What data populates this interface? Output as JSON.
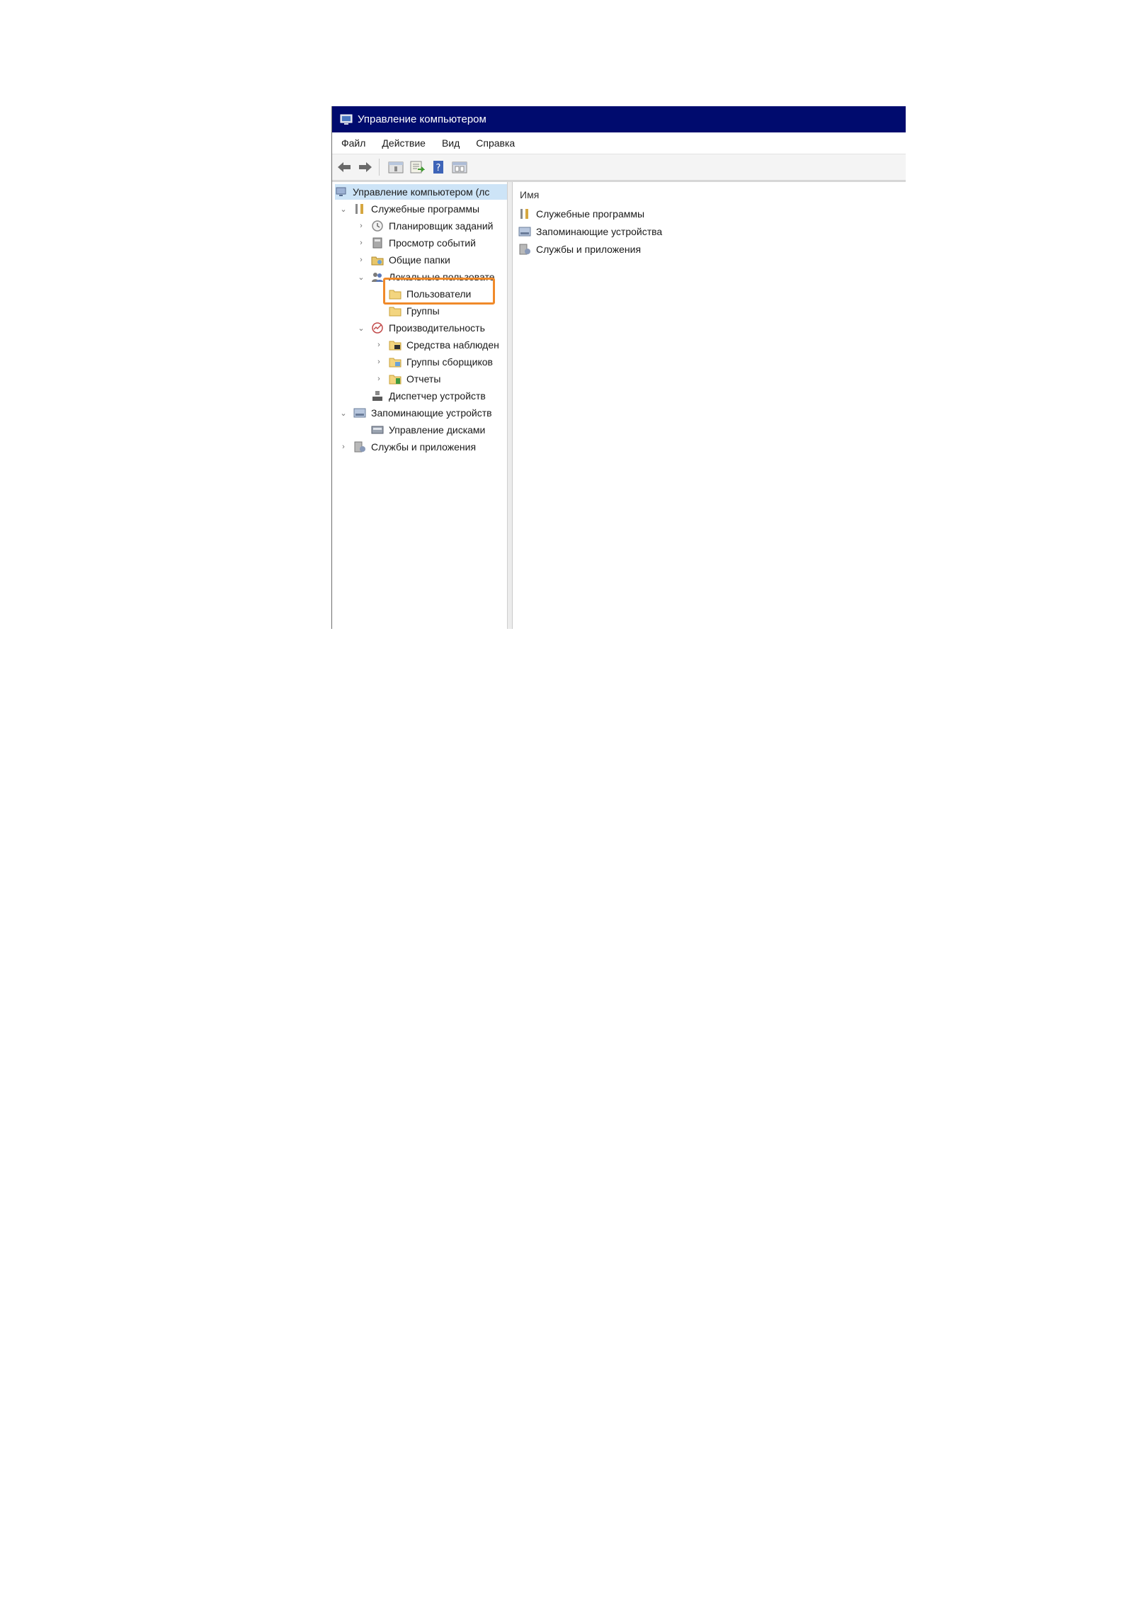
{
  "window": {
    "title": "Управление компьютером"
  },
  "menu": [
    "Файл",
    "Действие",
    "Вид",
    "Справка"
  ],
  "toolbar": {
    "buttons": [
      {
        "name": "back-icon"
      },
      {
        "name": "forward-icon"
      },
      {
        "name": "up-folder-icon"
      },
      {
        "name": "export-list-icon"
      },
      {
        "name": "help-icon"
      },
      {
        "name": "properties-icon"
      }
    ]
  },
  "tree": {
    "root": "Управление компьютером (лс",
    "utilities": "Служебные программы",
    "scheduler": "Планировщик заданий",
    "events": "Просмотр событий",
    "shared": "Общие папки",
    "local_users": "Локальные пользовате",
    "users": "Пользователи",
    "groups": "Группы",
    "performance": "Производительность",
    "monitoring_tools": "Средства наблюден",
    "collector_sets": "Группы сборщиков",
    "reports": "Отчеты",
    "device_manager": "Диспетчер устройств",
    "storage": "Запоминающие устройств",
    "disk_management": "Управление дисками",
    "services_apps": "Службы и приложения"
  },
  "list": {
    "header": "Имя",
    "items": [
      "Служебные программы",
      "Запоминающие устройства",
      "Службы и приложения"
    ]
  },
  "colors": {
    "titlebar": "#000b6e",
    "highlight": "#f08a2a"
  }
}
